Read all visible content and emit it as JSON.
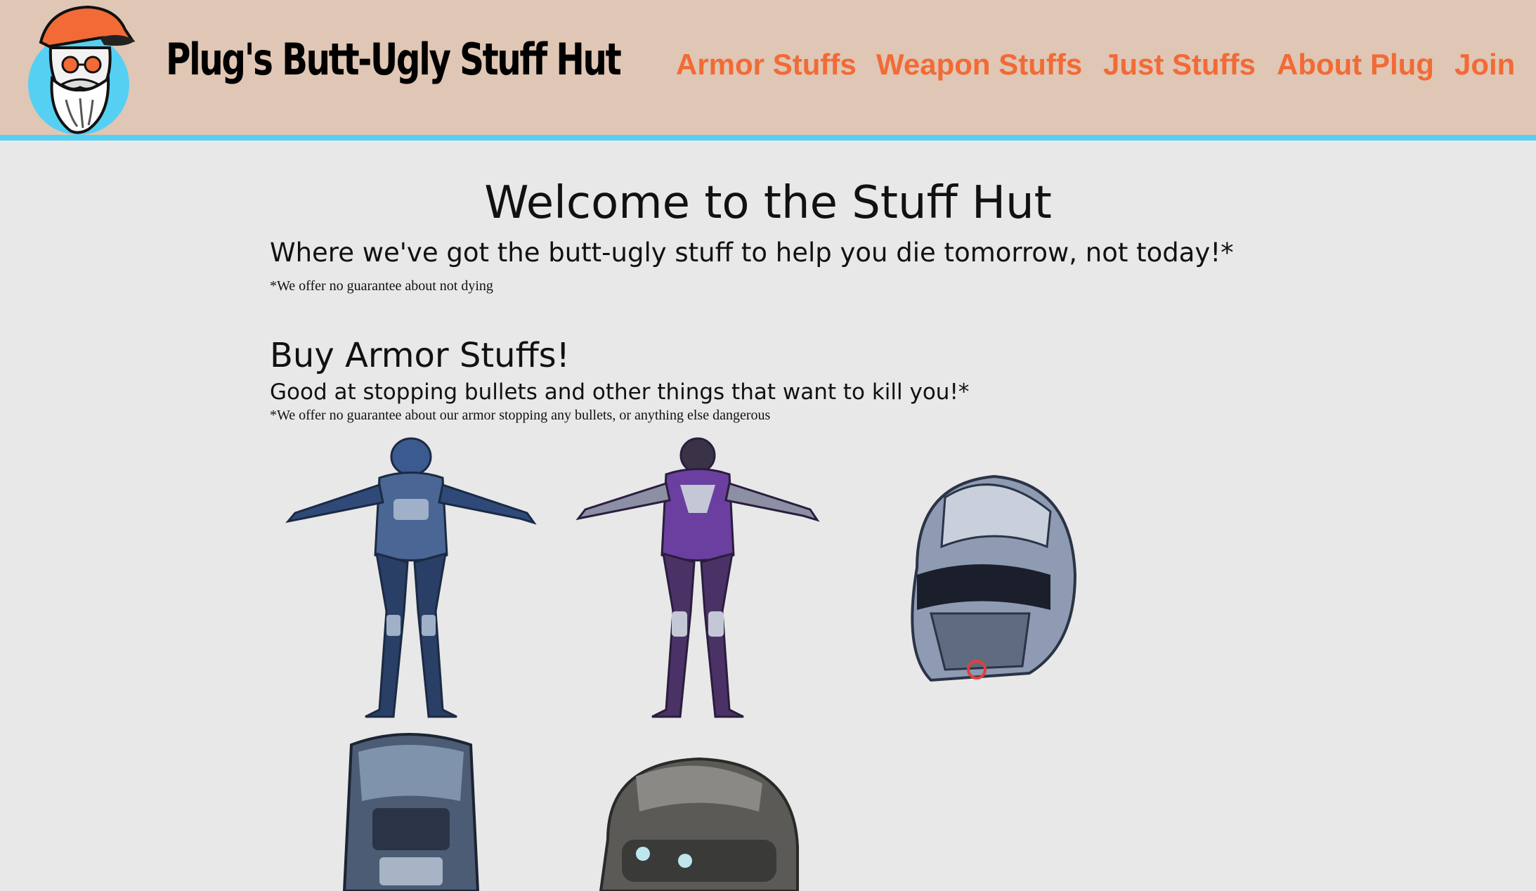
{
  "header": {
    "site_title": "Plug's Butt-Ugly Stuff Hut",
    "logo_alt": "Plug mascot logo",
    "nav": [
      {
        "label": "Armor Stuffs"
      },
      {
        "label": "Weapon Stuffs"
      },
      {
        "label": "Just Stuffs"
      },
      {
        "label": "About Plug"
      },
      {
        "label": "Join"
      }
    ]
  },
  "hero": {
    "title": "Welcome to the Stuff Hut",
    "tagline": "Where we've got the butt-ugly stuff to help you die tomorrow, not today!*",
    "disclaimer": "*We offer no guarantee about not dying"
  },
  "armor_section": {
    "title": "Buy Armor Stuffs!",
    "subtitle": "Good at stopping bullets and other things that want to kill you!*",
    "disclaimer": "*We offer no guarantee about our armor stopping any bullets, or anything else dangerous",
    "products": [
      {
        "icon": "blue-armor-suit-image"
      },
      {
        "icon": "purple-armor-suit-image"
      },
      {
        "icon": "blue-helmet-image"
      },
      {
        "icon": "chest-armor-image"
      },
      {
        "icon": "gray-helmet-image"
      }
    ]
  },
  "colors": {
    "header_bg": "#e0c6b4",
    "header_border": "#56d0f2",
    "nav_link": "#f26a35",
    "page_bg": "#e8e8e8"
  }
}
